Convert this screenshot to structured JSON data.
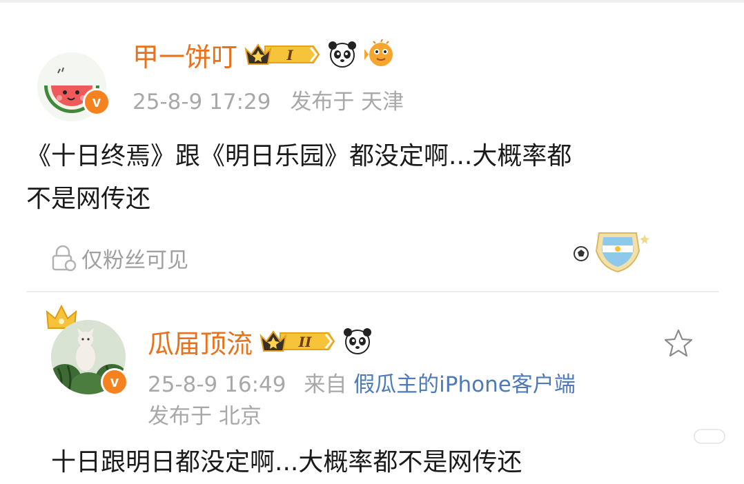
{
  "post1": {
    "username": "甲一饼叮",
    "vip_level": "I",
    "timestamp": "25-8-9 17:29",
    "location": "发布于 天津",
    "text_line1": "《十日终焉》跟《明日乐园》都没定啊...大概率都",
    "text_line2": "不是网传还",
    "visibility": "仅粉丝可见"
  },
  "post2": {
    "username": "瓜届顶流",
    "vip_level": "II",
    "timestamp": "25-8-9 16:49",
    "source_prefix": "来自",
    "source": "假瓜主的iPhone客户端",
    "location": "发布于 北京",
    "text": "十日跟明日都没定啊...大概率都不是网传还"
  },
  "icons": [
    "verified-badge-icon",
    "vip-crown-icon",
    "panda-icon",
    "puffer-fish-icon",
    "lock-icon",
    "football-icon",
    "argentina-medal-icon",
    "star-icon"
  ],
  "colors": {
    "username": "#e8721c",
    "meta": "#a8a8a8",
    "link": "#4d7ab8",
    "text": "#1a1a1a"
  }
}
